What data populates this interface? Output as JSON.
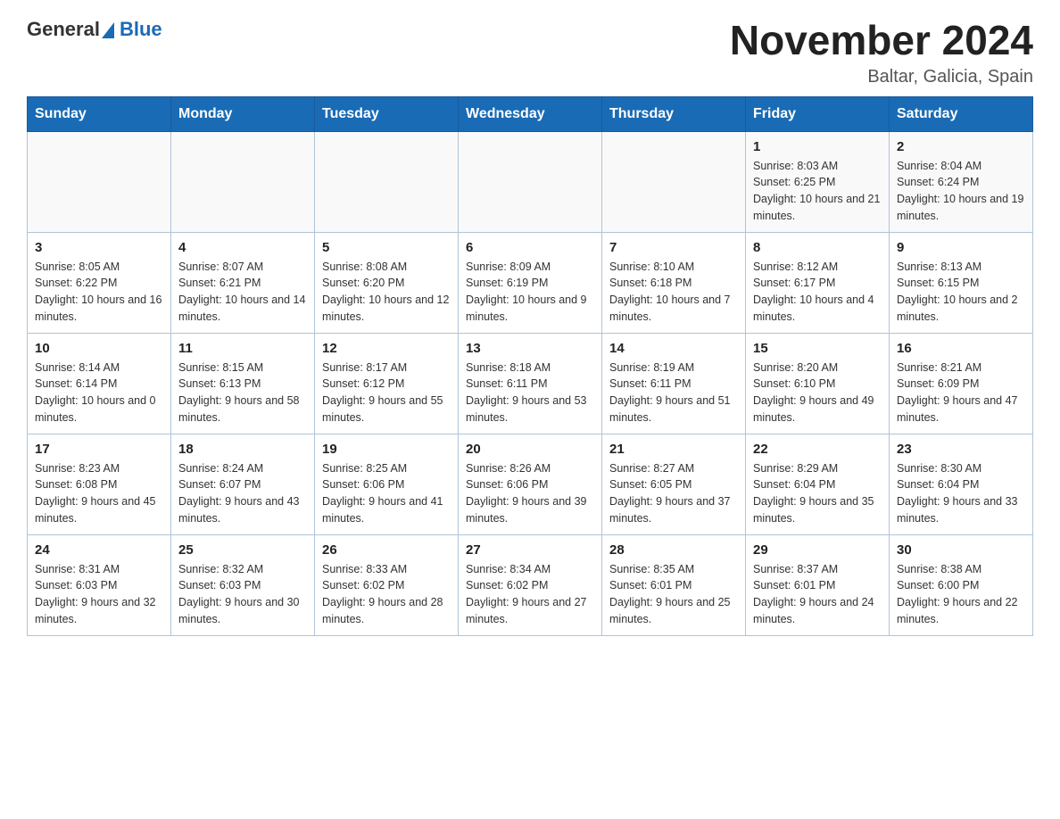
{
  "logo": {
    "text_general": "General",
    "text_blue": "Blue"
  },
  "title": "November 2024",
  "subtitle": "Baltar, Galicia, Spain",
  "days_of_week": [
    "Sunday",
    "Monday",
    "Tuesday",
    "Wednesday",
    "Thursday",
    "Friday",
    "Saturday"
  ],
  "weeks": [
    [
      {
        "day": "",
        "info": ""
      },
      {
        "day": "",
        "info": ""
      },
      {
        "day": "",
        "info": ""
      },
      {
        "day": "",
        "info": ""
      },
      {
        "day": "",
        "info": ""
      },
      {
        "day": "1",
        "info": "Sunrise: 8:03 AM\nSunset: 6:25 PM\nDaylight: 10 hours and 21 minutes."
      },
      {
        "day": "2",
        "info": "Sunrise: 8:04 AM\nSunset: 6:24 PM\nDaylight: 10 hours and 19 minutes."
      }
    ],
    [
      {
        "day": "3",
        "info": "Sunrise: 8:05 AM\nSunset: 6:22 PM\nDaylight: 10 hours and 16 minutes."
      },
      {
        "day": "4",
        "info": "Sunrise: 8:07 AM\nSunset: 6:21 PM\nDaylight: 10 hours and 14 minutes."
      },
      {
        "day": "5",
        "info": "Sunrise: 8:08 AM\nSunset: 6:20 PM\nDaylight: 10 hours and 12 minutes."
      },
      {
        "day": "6",
        "info": "Sunrise: 8:09 AM\nSunset: 6:19 PM\nDaylight: 10 hours and 9 minutes."
      },
      {
        "day": "7",
        "info": "Sunrise: 8:10 AM\nSunset: 6:18 PM\nDaylight: 10 hours and 7 minutes."
      },
      {
        "day": "8",
        "info": "Sunrise: 8:12 AM\nSunset: 6:17 PM\nDaylight: 10 hours and 4 minutes."
      },
      {
        "day": "9",
        "info": "Sunrise: 8:13 AM\nSunset: 6:15 PM\nDaylight: 10 hours and 2 minutes."
      }
    ],
    [
      {
        "day": "10",
        "info": "Sunrise: 8:14 AM\nSunset: 6:14 PM\nDaylight: 10 hours and 0 minutes."
      },
      {
        "day": "11",
        "info": "Sunrise: 8:15 AM\nSunset: 6:13 PM\nDaylight: 9 hours and 58 minutes."
      },
      {
        "day": "12",
        "info": "Sunrise: 8:17 AM\nSunset: 6:12 PM\nDaylight: 9 hours and 55 minutes."
      },
      {
        "day": "13",
        "info": "Sunrise: 8:18 AM\nSunset: 6:11 PM\nDaylight: 9 hours and 53 minutes."
      },
      {
        "day": "14",
        "info": "Sunrise: 8:19 AM\nSunset: 6:11 PM\nDaylight: 9 hours and 51 minutes."
      },
      {
        "day": "15",
        "info": "Sunrise: 8:20 AM\nSunset: 6:10 PM\nDaylight: 9 hours and 49 minutes."
      },
      {
        "day": "16",
        "info": "Sunrise: 8:21 AM\nSunset: 6:09 PM\nDaylight: 9 hours and 47 minutes."
      }
    ],
    [
      {
        "day": "17",
        "info": "Sunrise: 8:23 AM\nSunset: 6:08 PM\nDaylight: 9 hours and 45 minutes."
      },
      {
        "day": "18",
        "info": "Sunrise: 8:24 AM\nSunset: 6:07 PM\nDaylight: 9 hours and 43 minutes."
      },
      {
        "day": "19",
        "info": "Sunrise: 8:25 AM\nSunset: 6:06 PM\nDaylight: 9 hours and 41 minutes."
      },
      {
        "day": "20",
        "info": "Sunrise: 8:26 AM\nSunset: 6:06 PM\nDaylight: 9 hours and 39 minutes."
      },
      {
        "day": "21",
        "info": "Sunrise: 8:27 AM\nSunset: 6:05 PM\nDaylight: 9 hours and 37 minutes."
      },
      {
        "day": "22",
        "info": "Sunrise: 8:29 AM\nSunset: 6:04 PM\nDaylight: 9 hours and 35 minutes."
      },
      {
        "day": "23",
        "info": "Sunrise: 8:30 AM\nSunset: 6:04 PM\nDaylight: 9 hours and 33 minutes."
      }
    ],
    [
      {
        "day": "24",
        "info": "Sunrise: 8:31 AM\nSunset: 6:03 PM\nDaylight: 9 hours and 32 minutes."
      },
      {
        "day": "25",
        "info": "Sunrise: 8:32 AM\nSunset: 6:03 PM\nDaylight: 9 hours and 30 minutes."
      },
      {
        "day": "26",
        "info": "Sunrise: 8:33 AM\nSunset: 6:02 PM\nDaylight: 9 hours and 28 minutes."
      },
      {
        "day": "27",
        "info": "Sunrise: 8:34 AM\nSunset: 6:02 PM\nDaylight: 9 hours and 27 minutes."
      },
      {
        "day": "28",
        "info": "Sunrise: 8:35 AM\nSunset: 6:01 PM\nDaylight: 9 hours and 25 minutes."
      },
      {
        "day": "29",
        "info": "Sunrise: 8:37 AM\nSunset: 6:01 PM\nDaylight: 9 hours and 24 minutes."
      },
      {
        "day": "30",
        "info": "Sunrise: 8:38 AM\nSunset: 6:00 PM\nDaylight: 9 hours and 22 minutes."
      }
    ]
  ]
}
